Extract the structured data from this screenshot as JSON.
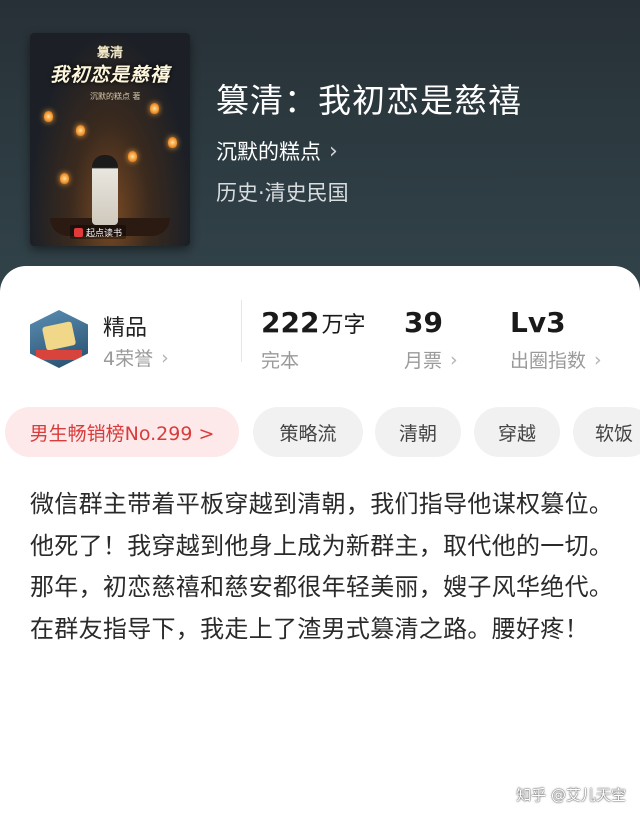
{
  "book": {
    "title": "篡清：我初恋是慈禧",
    "author": "沉默的糕点",
    "genre": "历史·清史民国",
    "cover": {
      "small_title": "篡清",
      "title": "我初恋是慈禧",
      "author_line": "沉默的糕点 著",
      "publisher": "起点读书"
    }
  },
  "stats": {
    "quality": {
      "label": "精品",
      "sub": "4荣誉"
    },
    "words": {
      "value": "222",
      "unit": "万字",
      "sub": "完本"
    },
    "tickets": {
      "value": "39",
      "sub": "月票"
    },
    "level": {
      "value": "Lv3",
      "sub": "出圈指数"
    }
  },
  "tags": [
    "男生畅销榜No.299 >",
    "策略流",
    "清朝",
    "穿越",
    "软饭"
  ],
  "description": [
    "微信群主带着平板穿越到清朝，我们指导他谋权篡位。",
    "他死了！我穿越到他身上成为新群主，取代他的一切。",
    "那年，初恋慈禧和慈安都很年轻美丽，嫂子风华绝代。",
    "在群友指导下，我走上了渣男式篡清之路。腰好疼！"
  ],
  "watermark": "知乎 @艾儿天空",
  "colors": {
    "header_bg": "#2c3a40",
    "rank_tag_bg": "#fde9e9",
    "rank_tag_text": "#d93c3c",
    "tag_bg": "#f1f1f1"
  }
}
